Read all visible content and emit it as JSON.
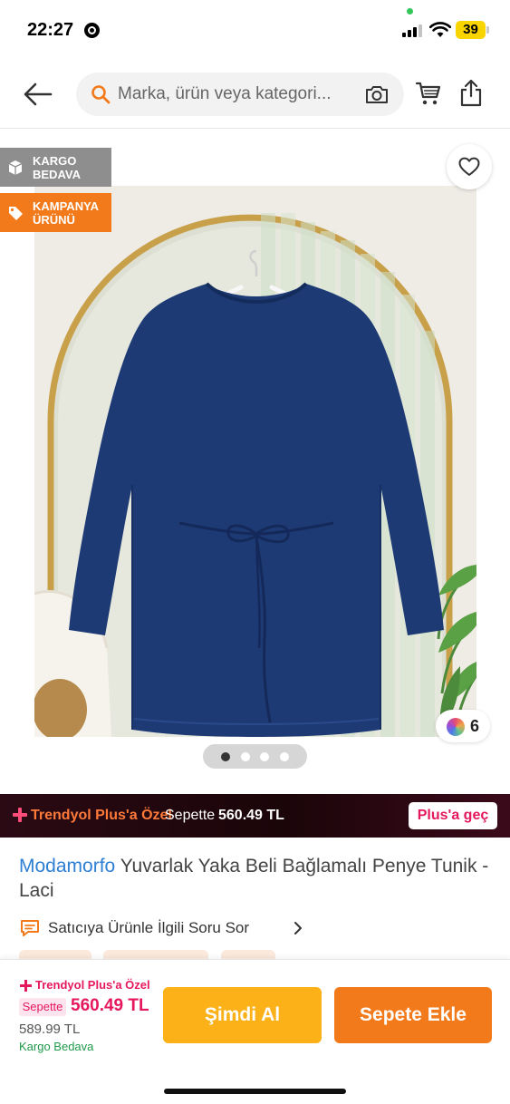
{
  "status_bar": {
    "time": "22:27",
    "battery": "39"
  },
  "header": {
    "search_placeholder": "Marka, ürün veya kategori..."
  },
  "badges": {
    "kargo": "KARGO BEDAVA",
    "kampanya": "KAMPANYA ÜRÜNÜ"
  },
  "gallery": {
    "color_count": "6",
    "page_count": 4,
    "active_page": 1
  },
  "plus_banner": {
    "title": "Trendyol Plus'a Özel",
    "price_label": "Sepette",
    "price": "560.49 TL",
    "cta": "Plus'a geç"
  },
  "product": {
    "brand": "Modamorfo",
    "name": "Yuvarlak Yaka Beli Bağlamalı Penye Tunik -Laci",
    "question_link": "Satıcıya Ürünle İlgili Soru Sor"
  },
  "bottom_bar": {
    "plus_title": "Trendyol Plus'a Özel",
    "sepette_label": "Sepette",
    "plus_price": "560.49 TL",
    "old_price": "589.99 TL",
    "shipping": "Kargo Bedava",
    "buy_now": "Şimdi Al",
    "add_to_cart": "Sepete Ekle"
  },
  "colors": {
    "brand_orange": "#f27a1a",
    "buy_now_yellow": "#fbb117",
    "plus_pink": "#e5185d",
    "link_blue": "#2d7fd3",
    "shipping_green": "#1f9a4a"
  }
}
